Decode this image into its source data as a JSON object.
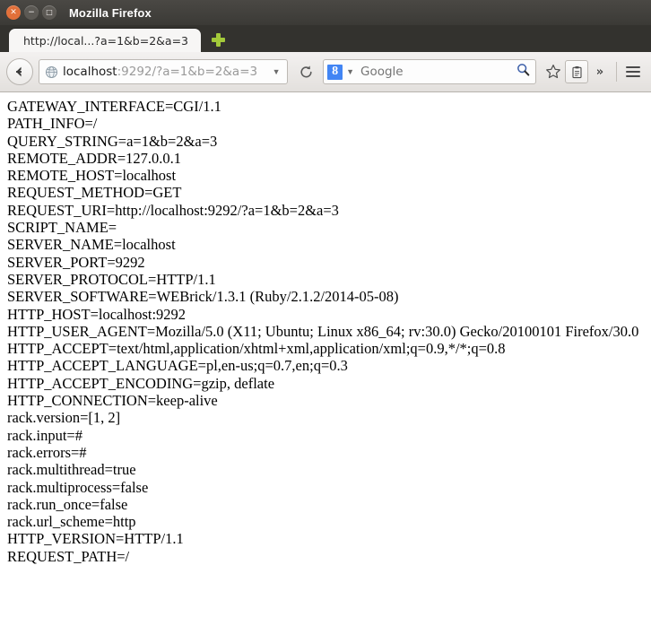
{
  "window": {
    "title": "Mozilla Firefox",
    "controls": [
      {
        "name": "close",
        "glyph": "✕"
      },
      {
        "name": "minimize",
        "glyph": "−"
      },
      {
        "name": "maximize",
        "glyph": "□"
      }
    ]
  },
  "tabs": {
    "active_label": "http://local...?a=1&b=2&a=3",
    "new_tab_tooltip": "+"
  },
  "navbar": {
    "back_glyph": "←",
    "url_host": "localhost",
    "url_rest": ":9292/?a=1&b=2&a=3",
    "url_dropdown_glyph": "▼",
    "reload_glyph": "⟳",
    "search_engine_initial": "8",
    "search_dropdown_glyph": "▼",
    "search_placeholder": "Google",
    "overflow_glyph": "»"
  },
  "page": {
    "lines": [
      "GATEWAY_INTERFACE=CGI/1.1",
      "PATH_INFO=/",
      "QUERY_STRING=a=1&b=2&a=3",
      "REMOTE_ADDR=127.0.0.1",
      "REMOTE_HOST=localhost",
      "REQUEST_METHOD=GET",
      "REQUEST_URI=http://localhost:9292/?a=1&b=2&a=3",
      "SCRIPT_NAME=",
      "SERVER_NAME=localhost",
      "SERVER_PORT=9292",
      "SERVER_PROTOCOL=HTTP/1.1",
      "SERVER_SOFTWARE=WEBrick/1.3.1 (Ruby/2.1.2/2014-05-08)",
      "HTTP_HOST=localhost:9292",
      "HTTP_USER_AGENT=Mozilla/5.0 (X11; Ubuntu; Linux x86_64; rv:30.0) Gecko/20100101 Firefox/30.0",
      "HTTP_ACCEPT=text/html,application/xhtml+xml,application/xml;q=0.9,*/*;q=0.8",
      "HTTP_ACCEPT_LANGUAGE=pl,en-us;q=0.7,en;q=0.3",
      "HTTP_ACCEPT_ENCODING=gzip, deflate",
      "HTTP_CONNECTION=keep-alive",
      "rack.version=[1, 2]",
      "rack.input=#",
      "rack.errors=#",
      "rack.multithread=true",
      "rack.multiprocess=false",
      "rack.run_once=false",
      "rack.url_scheme=http",
      "HTTP_VERSION=HTTP/1.1",
      "REQUEST_PATH=/"
    ]
  },
  "colors": {
    "titlebar": "#3b3a36",
    "tabstrip": "#33322e",
    "close_button": "#e2703a",
    "newtab_plus": "#a3c93a",
    "google_blue": "#4285f4",
    "navbar_bg": "#e8e5e2",
    "content_bg": "#ffffff",
    "text": "#000000"
  }
}
